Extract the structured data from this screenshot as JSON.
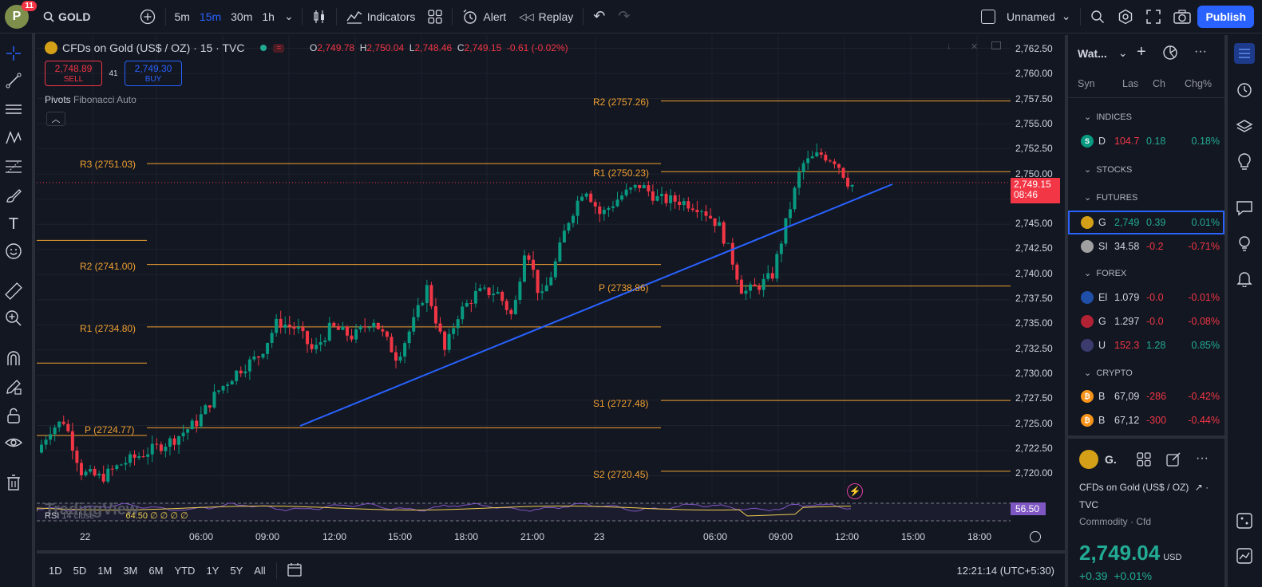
{
  "header": {
    "avatar_letter": "P",
    "avatar_badge": "11",
    "symbol": "GOLD",
    "timeframes": [
      "5m",
      "15m",
      "30m",
      "1h"
    ],
    "indicators_label": "Indicators",
    "alert_label": "Alert",
    "replay_label": "Replay",
    "layout_name": "Unnamed",
    "publish_label": "Publish"
  },
  "legend": {
    "title": "CFDs on Gold (US$ / OZ) · 15 · TVC",
    "o_label": "O",
    "o": "2,749.78",
    "h_label": "H",
    "h": "2,750.04",
    "l_label": "L",
    "l": "2,748.46",
    "c_label": "C",
    "c": "2,749.15",
    "change": "-0.61 (-0.02%)",
    "sell_price": "2,748.89",
    "sell_label": "SELL",
    "spread": "41",
    "buy_price": "2,749.30",
    "buy_label": "BUY",
    "indicator_name": "Pivots",
    "indicator_params": "Fibonacci Auto",
    "rsi_label": "RSI",
    "rsi_params": "14 close",
    "rsi_values": "64.50  ∅  ∅  ∅  ∅",
    "watermark": "TradingView"
  },
  "pivots": {
    "left": [
      {
        "label": "R3 (2751.03)"
      },
      {
        "label": "R2 (2741.00)"
      },
      {
        "label": "R1 (2734.80)"
      },
      {
        "label": "P (2724.77)"
      }
    ],
    "right": [
      {
        "label": "R2 (2757.26)"
      },
      {
        "label": "R1 (2750.23)"
      },
      {
        "label": "P (2738.86)"
      },
      {
        "label": "S1 (2727.48)"
      },
      {
        "label": "S2 (2720.45)"
      }
    ]
  },
  "price_axis": {
    "ticks": [
      "2,762.50",
      "2,760.00",
      "2,757.50",
      "2,755.00",
      "2,752.50",
      "2,750.00",
      "2,747.50",
      "2,745.00",
      "2,742.50",
      "2,740.00",
      "2,737.50",
      "2,735.00",
      "2,732.50",
      "2,730.00",
      "2,727.50",
      "2,725.00",
      "2,722.50",
      "2,720.00"
    ],
    "current_price": "2,749.15",
    "countdown": "08:46",
    "rsi_value": "56.50"
  },
  "time_axis": {
    "ticks": [
      "22",
      "06:00",
      "09:00",
      "12:00",
      "15:00",
      "18:00",
      "21:00",
      "23",
      "06:00",
      "09:00",
      "12:00",
      "15:00",
      "18:00"
    ]
  },
  "bottom_bar": {
    "ranges": [
      "1D",
      "5D",
      "1M",
      "3M",
      "6M",
      "YTD",
      "1Y",
      "5Y",
      "All"
    ],
    "clock": "12:21:14 (UTC+5:30)"
  },
  "watchlist": {
    "title": "Wat...",
    "columns": [
      "Syn",
      "Las",
      "Ch",
      "Chg%"
    ],
    "sections": {
      "indices": "INDICES",
      "stocks": "STOCKS",
      "futures": "FUTURES",
      "forex": "FOREX",
      "crypto": "CRYPTO"
    },
    "rows": [
      {
        "sym": "D",
        "last": "104.7",
        "ch": "0.18",
        "chp": "0.18%",
        "dir": "pos",
        "icon": "S",
        "color": "#089981"
      },
      {
        "sym": "G",
        "last": "2,749",
        "ch": "0.39",
        "chp": "0.01%",
        "dir": "pos",
        "icon": "",
        "color": "#d4a017"
      },
      {
        "sym": "SI",
        "last": "34.58",
        "ch": "-0.2",
        "chp": "-0.71%",
        "dir": "neg",
        "icon": "",
        "color": "#a0a0a0"
      },
      {
        "sym": "El",
        "last": "1.079",
        "ch": "-0.0",
        "chp": "-0.01%",
        "dir": "neg",
        "icon": "",
        "color": "#1f4fa8"
      },
      {
        "sym": "G",
        "last": "1.297",
        "ch": "-0.0",
        "chp": "-0.08%",
        "dir": "neg",
        "icon": "",
        "color": "#b22234"
      },
      {
        "sym": "U",
        "last": "152.3",
        "ch": "1.28",
        "chp": "0.85%",
        "dir": "pos",
        "icon": "",
        "color": "#3c3b6e"
      },
      {
        "sym": "B",
        "last": "67,09",
        "ch": "-286",
        "chp": "-0.42%",
        "dir": "neg",
        "icon": "₿",
        "color": "#f7931a"
      },
      {
        "sym": "B",
        "last": "67,12",
        "ch": "-300",
        "chp": "-0.44%",
        "dir": "neg",
        "icon": "₿",
        "color": "#f7931a"
      }
    ]
  },
  "details": {
    "symbol_short": "G.",
    "name": "CFDs on Gold (US$ / OZ)",
    "exchange": "TVC",
    "category": "Commodity · Cfd",
    "price": "2,749.04",
    "currency": "USD",
    "change": "+0.39",
    "change_pct": "+0.01%"
  },
  "colors": {
    "bg": "#131722",
    "up": "#089981",
    "down": "#f23645",
    "pivot": "#f0a030",
    "trendline": "#2962ff",
    "accent": "#2962ff"
  }
}
